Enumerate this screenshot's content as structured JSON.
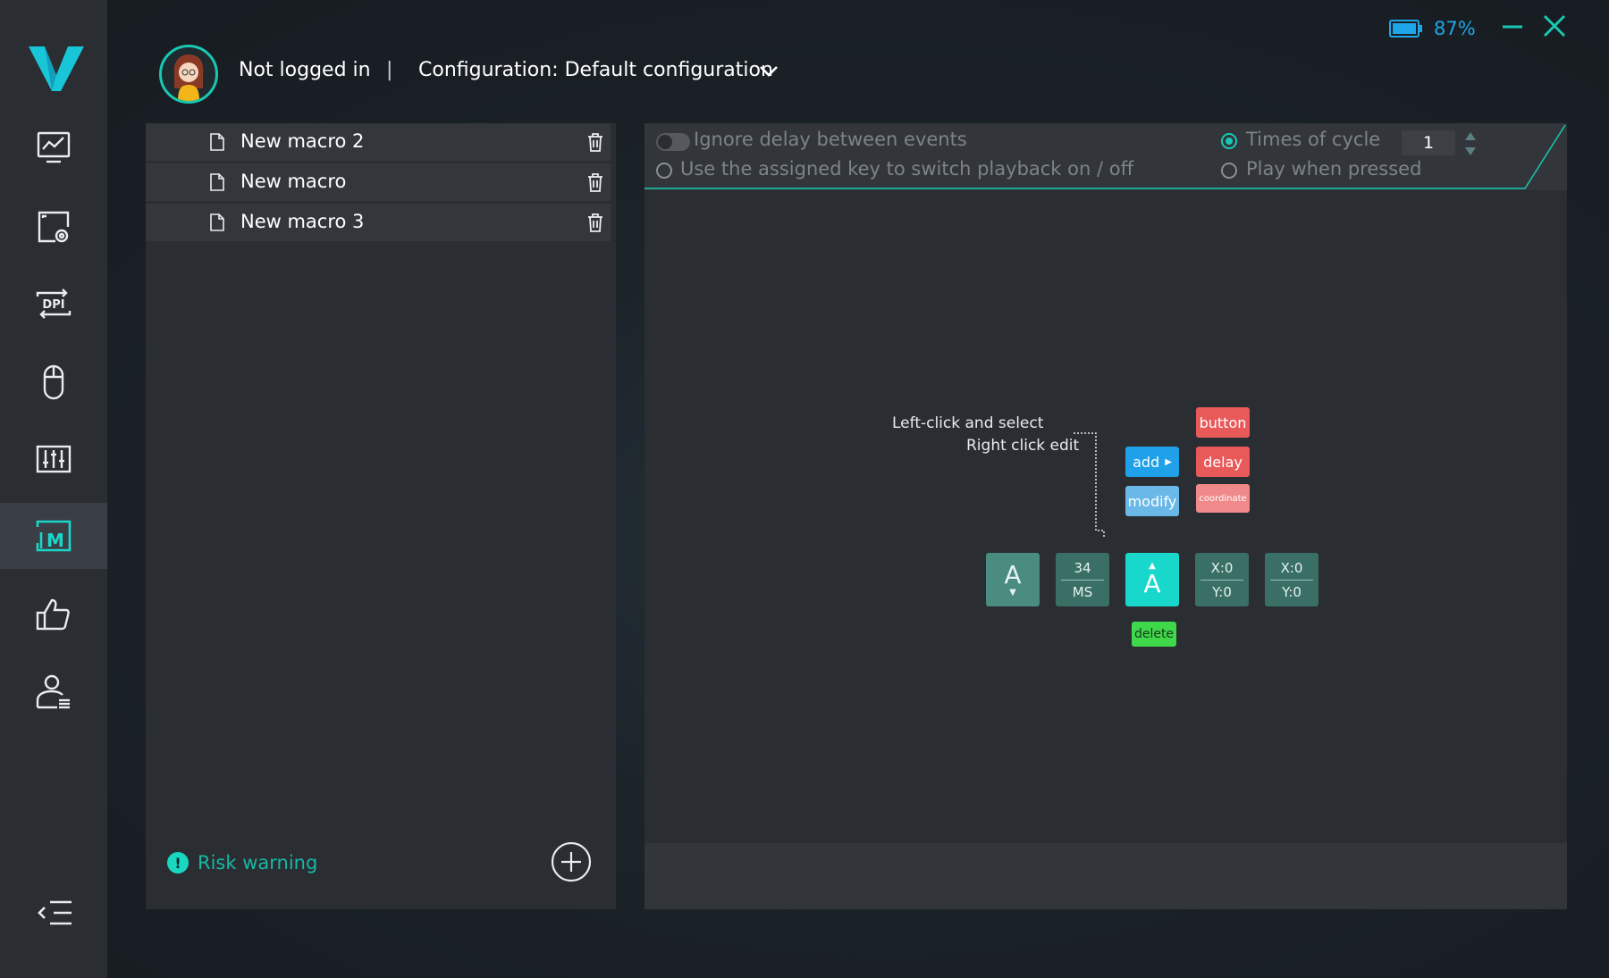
{
  "header": {
    "login_status": "Not logged in",
    "separator": "|",
    "configuration": "Configuration: Default configuration",
    "battery_percent": "87%"
  },
  "sidebar": {
    "items": [
      {
        "icon": "performance-chart-icon",
        "active": false
      },
      {
        "icon": "lighting-screen-icon",
        "active": false
      },
      {
        "icon": "dpi-icon",
        "active": false
      },
      {
        "icon": "mouse-icon",
        "active": false
      },
      {
        "icon": "equalizer-icon",
        "active": false
      },
      {
        "icon": "macro-icon",
        "active": true
      },
      {
        "icon": "thumbs-up-icon",
        "active": false
      },
      {
        "icon": "user-settings-icon",
        "active": false
      }
    ],
    "dpi_label": "DPI",
    "macro_letter": "M"
  },
  "macros": {
    "items": [
      {
        "name": "New macro 2"
      },
      {
        "name": "New macro"
      },
      {
        "name": "New macro 3"
      }
    ],
    "risk_warning": "Risk warning",
    "risk_icon_glyph": "!"
  },
  "options": {
    "ignore_delay": "Ignore delay between events",
    "assigned_key": "Use the assigned key to switch playback on / off",
    "times_of_cycle": "Times of cycle",
    "cycle_value": "1",
    "play_when_pressed": "Play when pressed"
  },
  "tutorial": {
    "line1": "Left-click and select",
    "line2": "Right click edit",
    "add": "add",
    "modify": "modify",
    "button": "button",
    "delay": "delay",
    "coordinate": "coordinate",
    "delete": "delete",
    "tiles": {
      "key_down": "A",
      "delay_value": "34",
      "delay_unit": "MS",
      "key_up": "A",
      "x1": "X:0",
      "y1": "Y:0",
      "x2": "X:0",
      "y2": "Y:0"
    }
  },
  "colors": {
    "accent": "#18c8b2",
    "battery": "#1fa6e8",
    "add_blue": "#1fa0e8",
    "modify_blue": "#6ab8e8",
    "red": "#e85a5a",
    "coordinate_pink": "#f08a8a",
    "delete_green": "#3ed84a"
  }
}
